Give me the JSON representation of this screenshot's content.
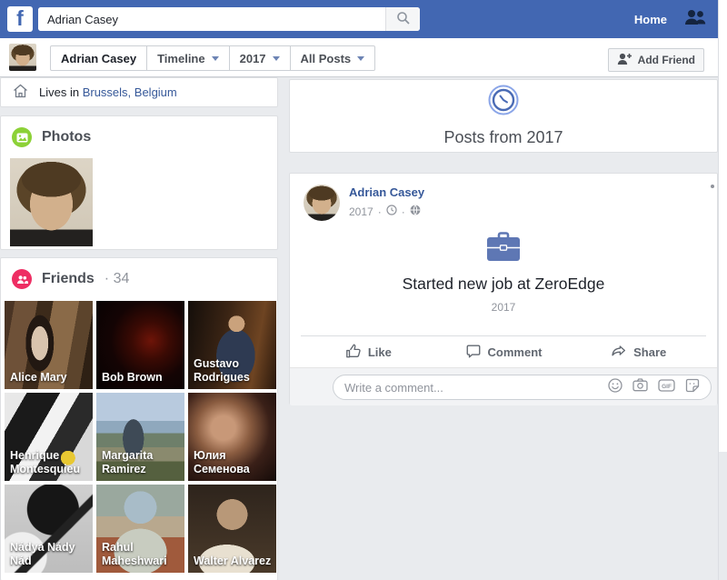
{
  "nav": {
    "logo_letter": "f",
    "search_value": "Adrian Casey",
    "home_label": "Home"
  },
  "toolbar": {
    "profile_name": "Adrian Casey",
    "timeline_label": "Timeline",
    "year_label": "2017",
    "filter_label": "All Posts",
    "add_friend_label": "Add Friend"
  },
  "sidebar": {
    "lives_in_prefix": "Lives in",
    "lives_in_location": "Brussels, Belgium",
    "photos_title": "Photos",
    "friends_title": "Friends",
    "friends_sep": "·",
    "friends_count": "34",
    "friends": [
      {
        "name": "Alice Mary"
      },
      {
        "name": "Bob Brown"
      },
      {
        "name": "Gustavo Rodrigues"
      },
      {
        "name": "Henrique Montesquieu"
      },
      {
        "name": "Margarita Ramirez"
      },
      {
        "name": "Юлия Семенова"
      },
      {
        "name": "Nádya Nády Nád"
      },
      {
        "name": "Rahul Maheshwari"
      },
      {
        "name": "Walter Alvarez"
      }
    ]
  },
  "main": {
    "year_banner": "Posts from 2017",
    "post": {
      "author": "Adrian Casey",
      "year": "2017",
      "meta_sep": "·",
      "title": "Started new job at ZeroEdge",
      "subtitle_year": "2017",
      "like_label": "Like",
      "comment_label": "Comment",
      "share_label": "Share",
      "comment_placeholder": "Write a comment...",
      "gif_icon_label": "GIF"
    }
  },
  "colors": {
    "navbar_blue": "#4267b2",
    "link_blue": "#365899",
    "photos_icon_green": "#8cd137",
    "friends_icon_pink": "#ee2e63",
    "briefcase_blue": "#5e77b4",
    "page_background": "#e9ebee"
  }
}
